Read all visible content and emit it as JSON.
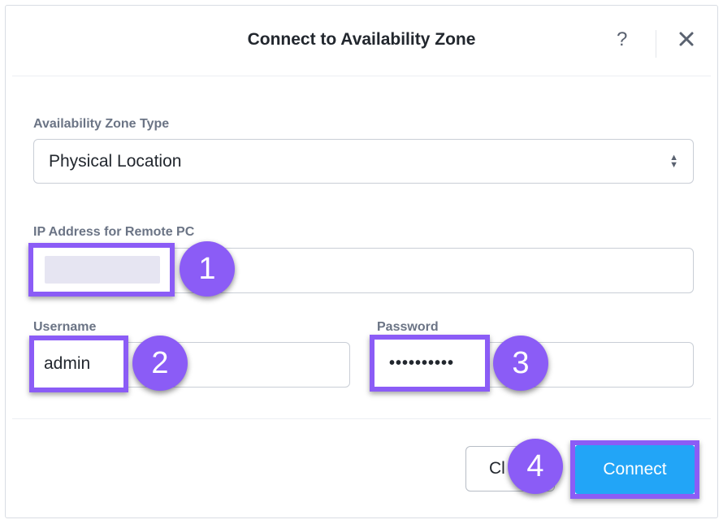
{
  "dialog": {
    "title": "Connect to Availability Zone",
    "help_icon": "?",
    "close_icon": "close-icon"
  },
  "zone_type": {
    "label": "Availability Zone Type",
    "value": "Physical Location"
  },
  "ip_address": {
    "label": "IP Address for Remote PC",
    "value": ""
  },
  "username": {
    "label": "Username",
    "value": "admin"
  },
  "password": {
    "label": "Password",
    "value": "••••••••••"
  },
  "buttons": {
    "close_label": "Cl",
    "connect_label": "Connect"
  },
  "steps": [
    "1",
    "2",
    "3",
    "4"
  ],
  "colors": {
    "highlight": "#8b5cf6",
    "primary": "#22a5f7"
  }
}
